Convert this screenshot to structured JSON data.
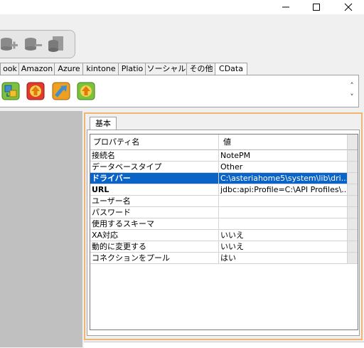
{
  "window": {
    "controls": [
      "minimize",
      "maximize",
      "close"
    ]
  },
  "db_toolbar": {
    "icons": [
      "db-add-icon",
      "db-remove-icon",
      "db-file-icon"
    ]
  },
  "adapter_tabs": [
    {
      "label": "ook",
      "active": false
    },
    {
      "label": "Amazon",
      "active": false
    },
    {
      "label": "Azure",
      "active": false
    },
    {
      "label": "kintone",
      "active": false
    },
    {
      "label": "Platio",
      "active": false
    },
    {
      "label": "ソーシャル",
      "active": false
    },
    {
      "label": "その他",
      "active": false
    },
    {
      "label": "CData",
      "active": true
    }
  ],
  "palette": {
    "icons": [
      "cdata-connection-icon",
      "cdata-get-icon",
      "cdata-put-icon",
      "cdata-execute-icon"
    ],
    "scroll_up": "˄",
    "scroll_down": "˅"
  },
  "properties": {
    "tab_label": "基本",
    "columns": {
      "name": "プロパティ名",
      "value": "値"
    },
    "rows": [
      {
        "name": "接続名",
        "value": "NotePM",
        "bold": false,
        "selected": false
      },
      {
        "name": "データベースタイプ",
        "value": "Other",
        "bold": false,
        "selected": false
      },
      {
        "name": "ドライバー",
        "value": "C:\\asteriahome5\\system\\lib\\dri...",
        "bold": true,
        "selected": true
      },
      {
        "name": "URL",
        "value": "jdbc:api:Profile=C:\\API Profiles\\...",
        "bold": true,
        "selected": false
      },
      {
        "name": "ユーザー名",
        "value": "",
        "bold": false,
        "selected": false
      },
      {
        "name": "パスワード",
        "value": "",
        "bold": false,
        "selected": false
      },
      {
        "name": "使用するスキーマ",
        "value": "",
        "bold": false,
        "selected": false
      },
      {
        "name": "XA対応",
        "value": "いいえ",
        "bold": false,
        "selected": false
      },
      {
        "name": "動的に変更する",
        "value": "いいえ",
        "bold": false,
        "selected": false
      },
      {
        "name": "コネクションをプール",
        "value": "はい",
        "bold": false,
        "selected": false
      }
    ]
  },
  "colors": {
    "selection": "#0a64c8",
    "panel_border": "#f0b571",
    "canvas": "#c0c0c0"
  }
}
